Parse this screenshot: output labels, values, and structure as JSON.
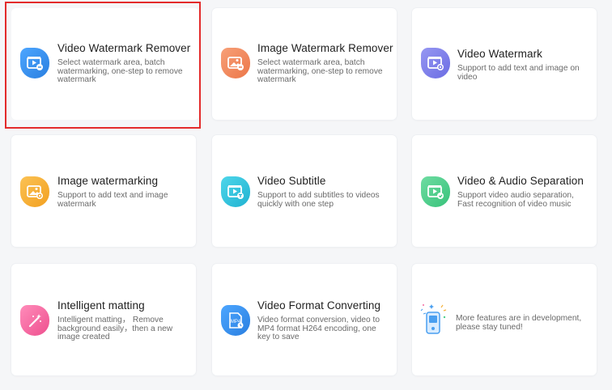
{
  "features": [
    {
      "title": "Video Watermark Remover",
      "desc": "Select watermark area, batch watermarking, one-step to remove watermark",
      "icon": "video-watermark-remover-icon",
      "color": "#2f8be8"
    },
    {
      "title": "Image Watermark Remover",
      "desc": "Select watermark area, batch watermarking, one-step to remove watermark",
      "icon": "image-watermark-remover-icon",
      "color": "#f08a5c"
    },
    {
      "title": "Video Watermark",
      "desc": "Support to add text and image on video",
      "icon": "video-watermark-icon",
      "color": "#7f80ea"
    },
    {
      "title": "Image watermarking",
      "desc": "Support to add text and image watermark",
      "icon": "image-watermarking-icon",
      "color": "#f6b23c"
    },
    {
      "title": "Video Subtitle",
      "desc": "Support to add subtitles to videos quickly with one step",
      "icon": "video-subtitle-icon",
      "color": "#2fc3dd"
    },
    {
      "title": "Video & Audio Separation",
      "desc": "Support video audio separation, Fast recognition of video music",
      "icon": "video-audio-separation-icon",
      "color": "#4fcf8d"
    },
    {
      "title": "Intelligent matting",
      "desc": "Intelligent matting， Remove background easily，then a new image created",
      "icon": "magic-wand-icon",
      "color": "#f46aa0"
    },
    {
      "title": "Video Format Converting",
      "desc": "Video format conversion, video to MP4 format H264 encoding, one key to save",
      "icon": "mp4-file-icon",
      "color": "#2f8be8",
      "icon_text": "MP4"
    },
    {
      "title": "",
      "desc": "More features are in development, please stay tuned!",
      "icon": "in-development-illustration",
      "color": "#4a9ff0"
    }
  ]
}
